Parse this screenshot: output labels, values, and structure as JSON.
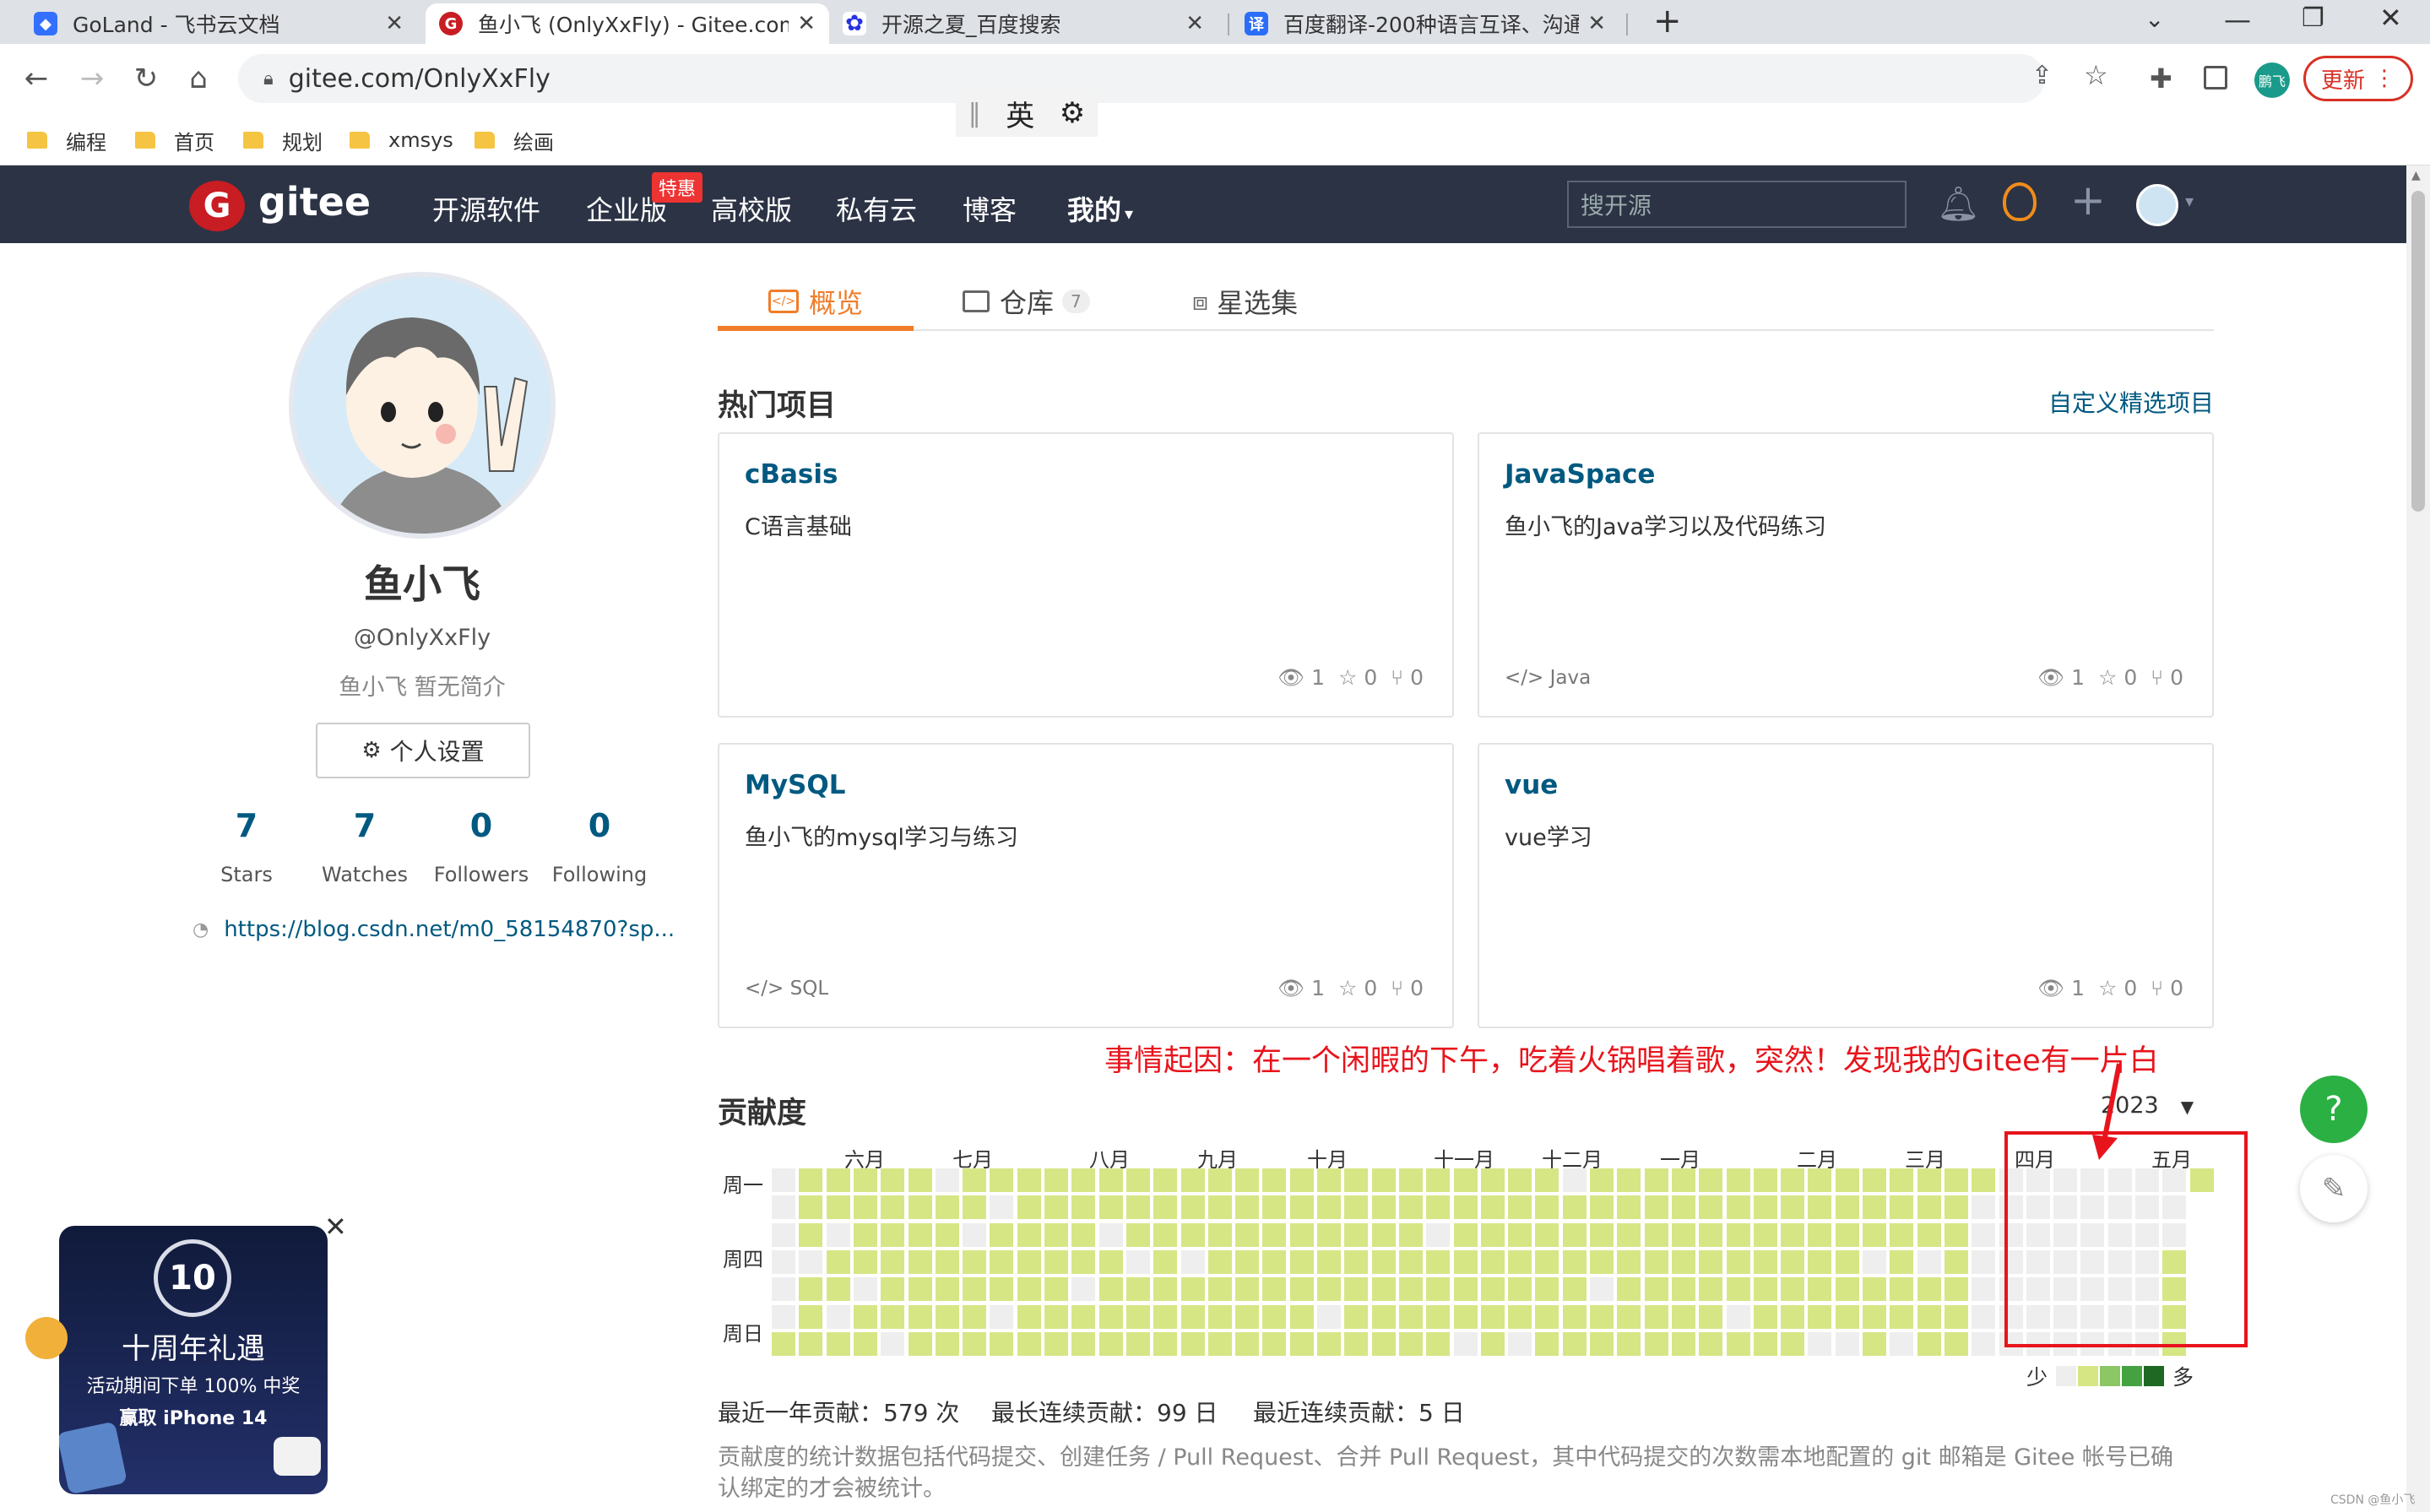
{
  "browser": {
    "tabs": [
      {
        "title": "GoLand - 飞书云文档",
        "favicon_color": "#3370ff",
        "favicon_glyph": "◆"
      },
      {
        "title": "鱼小飞 (OnlyXxFly) - Gitee.com",
        "favicon_color": "#c71d23",
        "favicon_glyph": "G"
      },
      {
        "title": "开源之夏_百度搜索",
        "favicon_color": "#2932e1",
        "favicon_glyph": "✿"
      },
      {
        "title": "百度翻译-200种语言互译、沟通全世界",
        "favicon_color": "#2b6df6",
        "favicon_glyph": "译"
      }
    ],
    "url": "gitee.com/OnlyXxFly",
    "profile_name": "鹏飞",
    "update_label": "更新",
    "bookmarks": [
      "编程",
      "首页",
      "规划",
      "xmsys",
      "绘画"
    ],
    "ime": {
      "lang": "英",
      "settings_icon": "gear-icon"
    }
  },
  "gitee": {
    "logo_text": "gitee",
    "nav": [
      "开源软件",
      "企业版",
      "高校版",
      "私有云",
      "博客",
      "我的"
    ],
    "hot_badge": "特惠",
    "search_placeholder": "搜开源"
  },
  "profile": {
    "name": "鱼小飞",
    "handle": "@OnlyXxFly",
    "bio": "鱼小飞 暂无简介",
    "settings_label": "个人设置",
    "counts": [
      {
        "value": "7",
        "label": "Stars"
      },
      {
        "value": "7",
        "label": "Watches"
      },
      {
        "value": "0",
        "label": "Followers"
      },
      {
        "value": "0",
        "label": "Following"
      }
    ],
    "blog_url": "https://blog.csdn.net/m0_58154870?sp..."
  },
  "tabs": {
    "overview": "概览",
    "repos": "仓库",
    "repos_count": "7",
    "stars": "星选集"
  },
  "hot_projects": {
    "title": "热门项目",
    "customize": "自定义精选项目",
    "cards": [
      {
        "name": "cBasis",
        "desc": "C语言基础",
        "lang": "",
        "watch": "1",
        "star": "0",
        "fork": "0"
      },
      {
        "name": "JavaSpace",
        "desc": "鱼小飞的Java学习以及代码练习",
        "lang": "Java",
        "watch": "1",
        "star": "0",
        "fork": "0"
      },
      {
        "name": "MySQL",
        "desc": "鱼小飞的mysql学习与练习",
        "lang": "SQL",
        "watch": "1",
        "star": "0",
        "fork": "0"
      },
      {
        "name": "vue",
        "desc": "vue学习",
        "lang": "",
        "watch": "1",
        "star": "0",
        "fork": "0"
      }
    ]
  },
  "annotation": "事情起因：在一个闲暇的下午，吃着火锅唱着歌，突然！发现我的Gitee有一片白",
  "contrib": {
    "title": "贡献度",
    "year": "2023",
    "months": [
      "六月",
      "七月",
      "八月",
      "九月",
      "十月",
      "十一月",
      "十二月",
      "一月",
      "二月",
      "三月",
      "四月",
      "五月"
    ],
    "days": [
      "周一",
      "周四",
      "周日"
    ],
    "legend_less": "少",
    "legend_more": "多",
    "legend_colors": [
      "#eeeeee",
      "#d6e685",
      "#8cc665",
      "#44a340",
      "#1e6823"
    ],
    "color_active": "#d6e685",
    "color_empty": "#eeeeee",
    "stats": [
      "最近一年贡献：579 次",
      "最长连续贡献：99 日",
      "最近连续贡献：5 日"
    ],
    "note": "贡献度的统计数据包括代码提交、创建任务 / Pull Request、合并 Pull Request，其中代码提交的次数需本地配置的 git 邮箱是 Gitee 帐号已确认绑定的才会被统计。"
  },
  "promo": {
    "line1": "十周年礼遇",
    "line2": "活动期间下单 100% 中奖",
    "line3": "赢取 iPhone 14"
  },
  "float": {
    "help": "?"
  },
  "watermark": "CSDN @鱼小飞"
}
